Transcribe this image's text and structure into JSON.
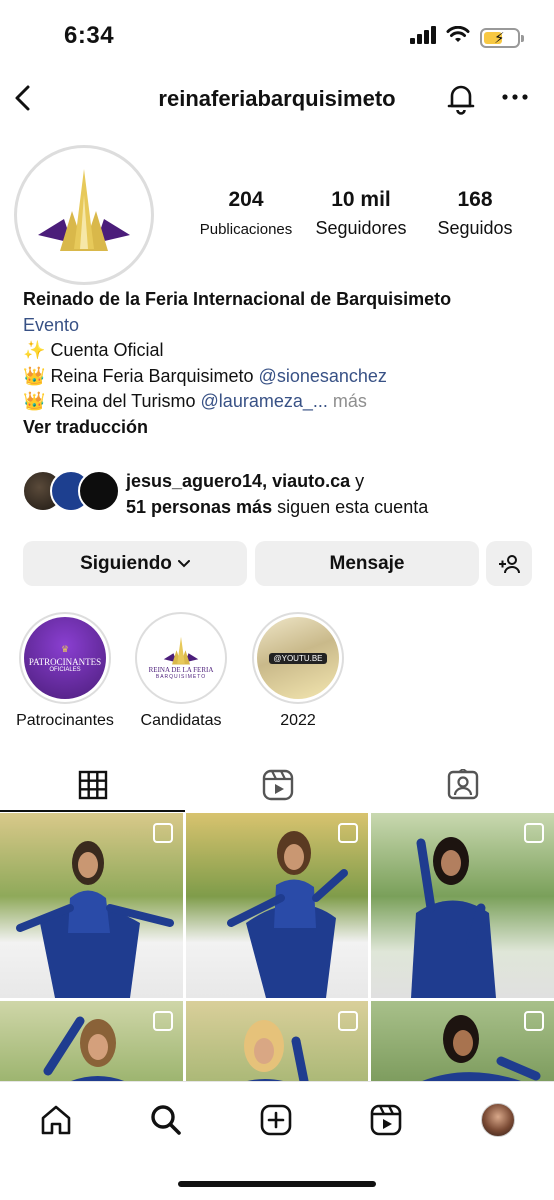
{
  "status_bar": {
    "time": "6:34",
    "icons": [
      "signal-icon",
      "wifi-icon",
      "battery-charging-icon"
    ]
  },
  "header": {
    "username": "reinaferiabarquisimeto",
    "icons": [
      "back-icon",
      "bell-icon",
      "more-icon"
    ]
  },
  "profile": {
    "stats": [
      {
        "value": "204",
        "label": "Publicaciones"
      },
      {
        "value": "10 mil",
        "label": "Seguidores"
      },
      {
        "value": "168",
        "label": "Seguidos"
      }
    ]
  },
  "bio": {
    "name": "Reinado de la Feria Internacional de Barquisimeto",
    "category": "Evento",
    "line1_emoji": "✨",
    "line1_text": "Cuenta Oficial",
    "line2_emoji": "👑",
    "line2_text": "Reina Feria Barquisimeto",
    "line2_mention": "@sionesanchez",
    "line3_emoji": "👑",
    "line3_text": "Reina del Turismo",
    "line3_mention": "@laurameza_...",
    "line3_more": "más",
    "translate": "Ver traducción"
  },
  "followed_by": {
    "names": "jesus_aguero14, viauto.ca",
    "conj": "y",
    "count": "51 personas más",
    "suffix": "siguen esta cuenta"
  },
  "actions": {
    "following": "Siguiendo",
    "message": "Mensaje"
  },
  "highlights": [
    {
      "label": "Patrocinantes",
      "cover_text": "Patrocinantes",
      "cover_sub": "Oficiales"
    },
    {
      "label": "Candidatas",
      "cover_text": "REINA DE LA FERIA",
      "cover_sub": "BARQUISIMETO"
    },
    {
      "label": "2022",
      "cover_text": "@YOUTU.BE"
    }
  ],
  "tabs": [
    "grid-icon",
    "reels-icon",
    "tagged-icon"
  ],
  "bottom_nav": [
    "home-icon",
    "search-icon",
    "create-icon",
    "reels-icon",
    "profile-avatar"
  ],
  "colors": {
    "link": "#385185",
    "button_bg": "#efefef",
    "brand_purple": "#4b1d7a",
    "brand_gold": "#d9b84a",
    "gown_blue": "#1f3c8f"
  }
}
